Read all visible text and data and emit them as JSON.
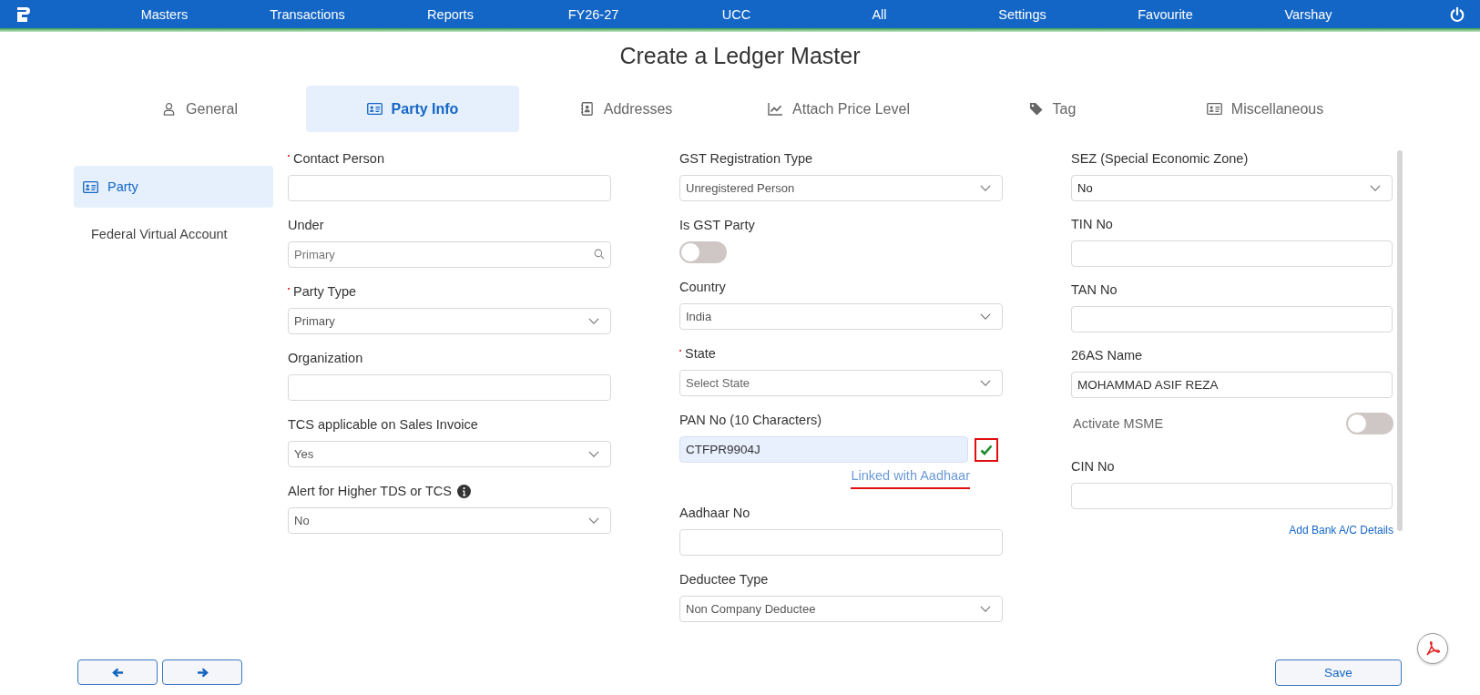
{
  "nav": {
    "items": [
      "Masters",
      "Transactions",
      "Reports",
      "FY26-27",
      "UCC",
      "All",
      "Settings",
      "Favourite",
      "Varshay"
    ]
  },
  "title": "Create a Ledger Master",
  "tabs": [
    {
      "label": "General",
      "selected": false
    },
    {
      "label": "Party Info",
      "selected": true
    },
    {
      "label": "Addresses",
      "selected": false
    },
    {
      "label": "Attach Price Level",
      "selected": false
    },
    {
      "label": "Tag",
      "selected": false
    },
    {
      "label": "Miscellaneous",
      "selected": false
    }
  ],
  "sidebar": {
    "items": [
      {
        "label": "Party",
        "selected": true,
        "icon": true
      },
      {
        "label": "Federal Virtual Account",
        "selected": false,
        "icon": false
      }
    ]
  },
  "columns": [
    [
      {
        "kind": "input",
        "label": "Contact Person",
        "required": true
      },
      {
        "kind": "search",
        "label": "Under",
        "placeholder": "Primary"
      },
      {
        "kind": "select",
        "label": "Party Type",
        "required": true,
        "value": "Primary"
      },
      {
        "kind": "input",
        "label": "Organization"
      },
      {
        "kind": "select",
        "label": "TCS applicable on Sales Invoice",
        "value": "Yes"
      },
      {
        "kind": "select",
        "label": "Alert for Higher TDS or TCS",
        "info": true,
        "value": "No"
      }
    ],
    [
      {
        "kind": "select",
        "label": "GST Registration Type",
        "value": "Unregistered Person"
      },
      {
        "kind": "toggle",
        "label": "Is GST Party",
        "on": false
      },
      {
        "kind": "select",
        "label": "Country",
        "value": "India"
      },
      {
        "kind": "select",
        "label": "State",
        "required": true,
        "placeholder": "Select State"
      },
      {
        "kind": "pan",
        "label": "PAN No (10 Characters)",
        "value": "CTFPR9904J",
        "verified": true,
        "annotated": true,
        "link": "Linked with Aadhaar"
      },
      {
        "kind": "input",
        "label": "Aadhaar No"
      },
      {
        "kind": "select",
        "label": "Deductee Type",
        "value": "Non Company Deductee"
      }
    ],
    [
      {
        "kind": "select",
        "label": "SEZ (Special Economic Zone)",
        "value": "No"
      },
      {
        "kind": "input",
        "label": "TIN No"
      },
      {
        "kind": "input",
        "label": "TAN No"
      },
      {
        "kind": "input",
        "label": "26AS Name",
        "value": "MOHAMMAD ASIF REZA"
      },
      {
        "kind": "inline-toggle",
        "label": "Activate MSME",
        "on": false
      },
      {
        "kind": "input",
        "label": "CIN No"
      },
      {
        "kind": "link",
        "label": "Add Bank A/C Details"
      }
    ]
  ],
  "footer": {
    "save": "Save"
  }
}
